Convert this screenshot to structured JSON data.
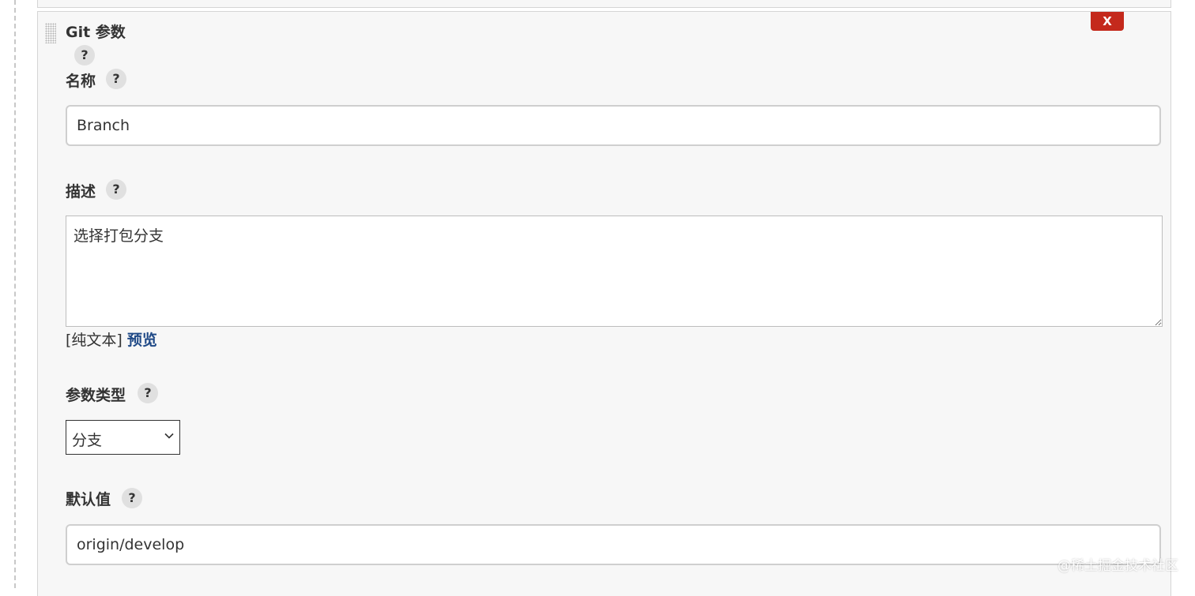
{
  "panel": {
    "title": "Git 参数",
    "close_label": "X",
    "help_symbol": "?"
  },
  "fields": {
    "name": {
      "label": "名称",
      "value": "Branch"
    },
    "description": {
      "label": "描述",
      "value": "选择打包分支",
      "format_text": "[纯文本]",
      "preview_link": "预览"
    },
    "param_type": {
      "label": "参数类型",
      "selected": "分支"
    },
    "default_value": {
      "label": "默认值",
      "value": "origin/develop"
    }
  },
  "watermark": "@稀土掘金技术社区",
  "colors": {
    "close_button": "#c4291c",
    "link": "#204a87",
    "panel_background": "#f7f7f7"
  },
  "icons": {
    "drag": "drag-handle-icon",
    "help": "help-icon",
    "dropdown": "chevron-down-icon"
  }
}
